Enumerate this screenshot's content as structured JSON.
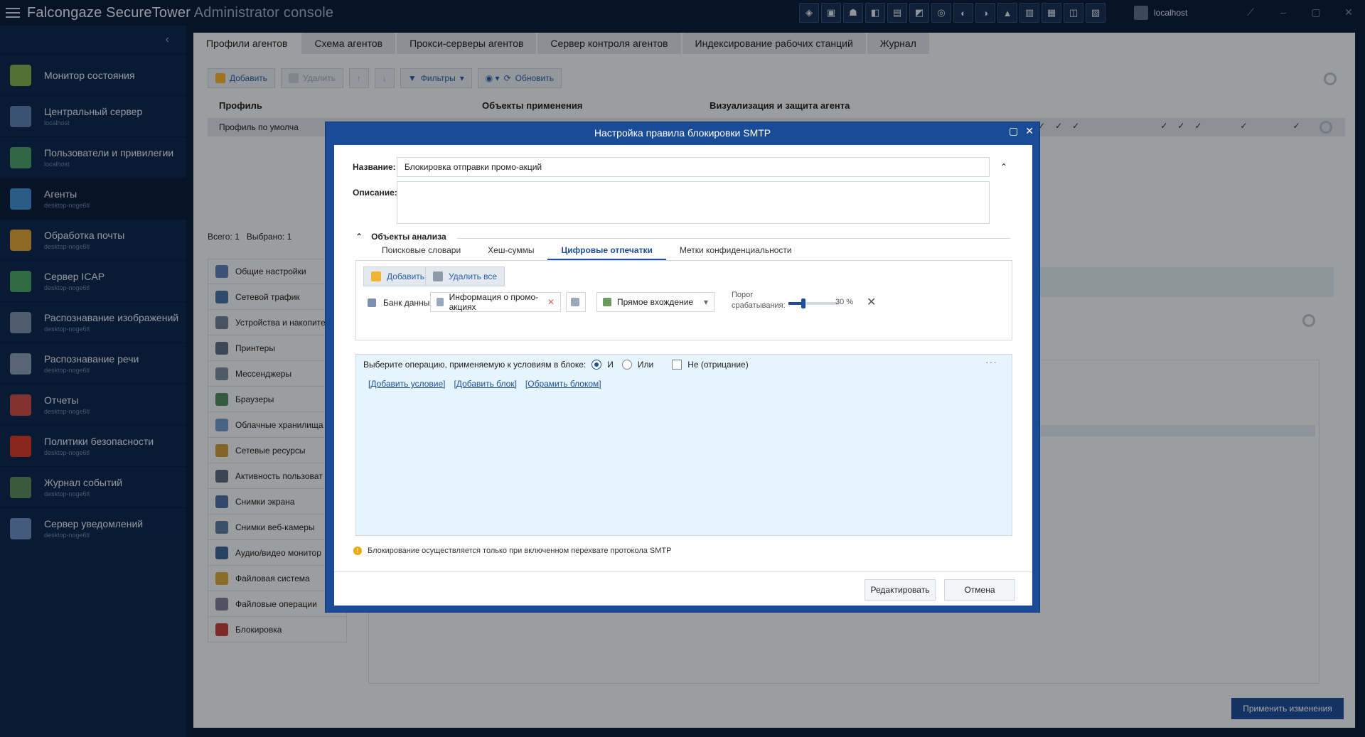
{
  "app": {
    "title_main": "Falcongaze SecureTower ",
    "title_sub": "Administrator console",
    "server": "localhost"
  },
  "toolbar_icons": [
    "shield-icon",
    "monitor-icon",
    "users-icon",
    "agents-icon",
    "mail-icon",
    "icap-icon",
    "image-icon",
    "speech-icon",
    "reports-icon",
    "policy-icon",
    "bars-icon",
    "log-icon",
    "notify-icon",
    "server-icon"
  ],
  "sidebar": {
    "items": [
      {
        "label": "Монитор состояния",
        "sub": "",
        "color": "#7fb04f"
      },
      {
        "label": "Центральный сервер",
        "sub": "localhost",
        "color": "#5a7db0"
      },
      {
        "label": "Пользователи и привилегии",
        "sub": "localhost",
        "color": "#4d9e6a"
      },
      {
        "label": "Агенты",
        "sub": "desktop-noge6tl",
        "color": "#3f8fd0"
      },
      {
        "label": "Обработка почты",
        "sub": "desktop-noge6tl",
        "color": "#d9a23a"
      },
      {
        "label": "Сервер ICAP",
        "sub": "desktop-noge6tl",
        "color": "#4ba36b"
      },
      {
        "label": "Распознавание изображений",
        "sub": "desktop-noge6tl",
        "color": "#7a8ea8"
      },
      {
        "label": "Распознавание речи",
        "sub": "desktop-noge6tl",
        "color": "#8a9bb3"
      },
      {
        "label": "Отчеты",
        "sub": "desktop-noge6tl",
        "color": "#c94d4d"
      },
      {
        "label": "Политики безопасности",
        "sub": "desktop-noge6tl",
        "color": "#d23b2f"
      },
      {
        "label": "Журнал событий",
        "sub": "desktop-noge6tl",
        "color": "#5b8a5c"
      },
      {
        "label": "Сервер уведомлений",
        "sub": "desktop-noge6tl",
        "color": "#6a8cc0"
      }
    ]
  },
  "tabs": [
    "Профили агентов",
    "Схема агентов",
    "Прокси-серверы агентов",
    "Сервер контроля агентов",
    "Индексирование рабочих станций",
    "Журнал"
  ],
  "toolbar": {
    "add": "Добавить",
    "delete": "Удалить",
    "filters": "Фильтры",
    "refresh": "Обновить"
  },
  "grid": {
    "col_profile": "Профиль",
    "col_objects": "Объекты применения",
    "col_visual": "Визуализация и защита агента",
    "row_profile": "Профиль по умолча"
  },
  "counts": {
    "total": "Всего: 1",
    "selected": "Выбрано: 1"
  },
  "settings_list": [
    "Общие настройки",
    "Сетевой трафик",
    "Устройства и накопите",
    "Принтеры",
    "Мессенджеры",
    "Браузеры",
    "Облачные хранилища",
    "Сетевые ресурсы",
    "Активность пользоват",
    "Снимки экрана",
    "Снимки веб-камеры",
    "Аудио/видео монитор",
    "Файловая система",
    "Файловые операции",
    "Блокировка"
  ],
  "apply_button": "Применить изменения",
  "modal": {
    "title": "Настройка правила блокировки SMTP",
    "name_label": "Название:",
    "name_value": "Блокировка отправки промо-акций",
    "desc_label": "Описание:",
    "section_title": "Объекты анализа",
    "inner_tabs": [
      "Поисковые словари",
      "Хеш-суммы",
      "Цифровые отпечатки",
      "Метки конфиденциальности"
    ],
    "add": "Добавить",
    "delete_all": "Удалить все",
    "databank_label": "Банк данных",
    "databank_value": "Информация о промо-акциях",
    "match_type": "Прямое вхождение",
    "threshold_label": "Порог срабатывания:",
    "threshold_value": "30 %",
    "threshold_fraction": 0.3,
    "operation_label": "Выберите операцию, применяемую к условиям в блоке:",
    "op_and": "И",
    "op_or": "Или",
    "op_not": "Не (отрицание)",
    "link_add_condition": "[Добавить условие]",
    "link_add_block": "[Добавить блок]",
    "link_wrap_block": "[Обрамить блоком]",
    "warning": "Блокирование осуществляется только при включенном перехвате протокола SMTP",
    "edit_button": "Редактировать",
    "cancel_button": "Отмена"
  }
}
